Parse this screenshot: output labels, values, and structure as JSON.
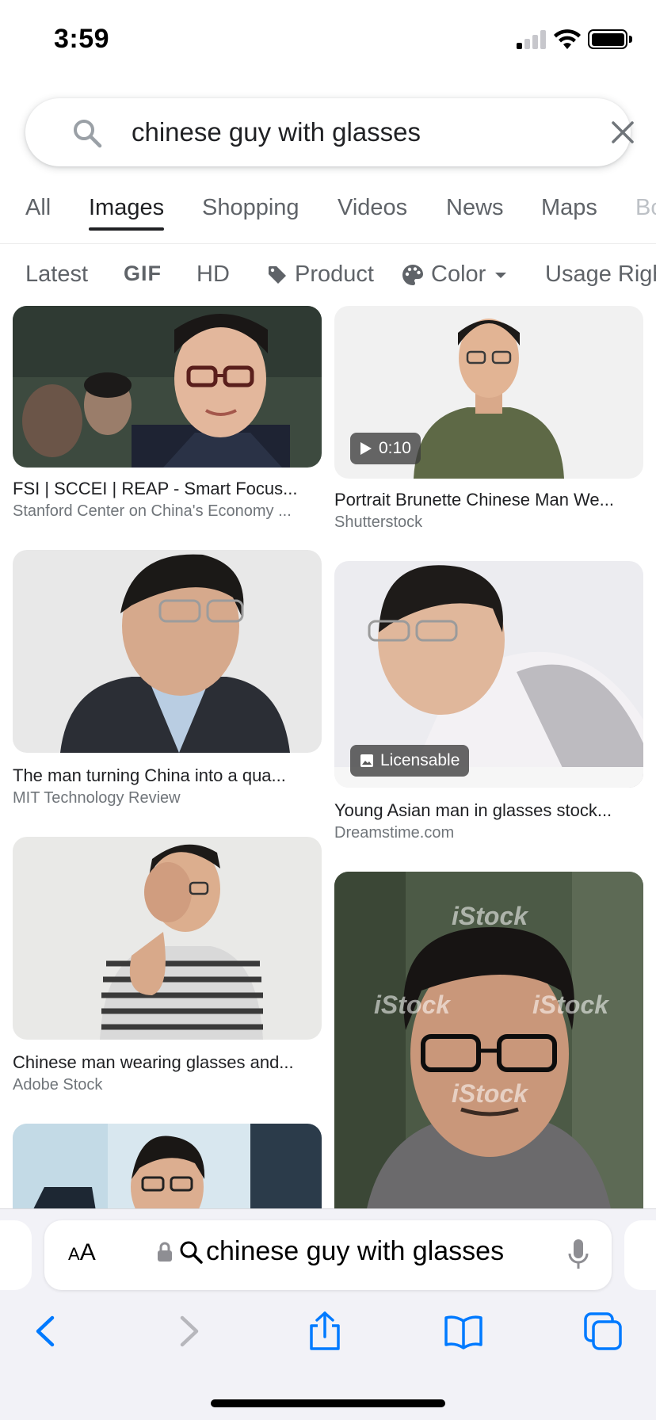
{
  "status_bar": {
    "time": "3:59"
  },
  "search": {
    "query": "chinese guy with glasses"
  },
  "tabs": [
    {
      "label": "All"
    },
    {
      "label": "Images"
    },
    {
      "label": "Shopping"
    },
    {
      "label": "Videos"
    },
    {
      "label": "News"
    },
    {
      "label": "Maps"
    },
    {
      "label": "Bo"
    }
  ],
  "filters": [
    {
      "label": "Latest"
    },
    {
      "label": "GIF"
    },
    {
      "label": "HD"
    },
    {
      "label": "Product"
    },
    {
      "label": "Color"
    },
    {
      "label": "Usage Righ"
    }
  ],
  "results": [
    {
      "title": "FSI | SCCEI | REAP - Smart Focus...",
      "source": "Stanford Center on China's Economy ..."
    },
    {
      "title": "Portrait Brunette Chinese Man We...",
      "source": "Shutterstock",
      "badge": "0:10"
    },
    {
      "title": "The man turning China into a qua...",
      "source": "MIT Technology Review"
    },
    {
      "title": "Young Asian man in glasses stock...",
      "source": "Dreamstime.com",
      "badge": "Licensable"
    },
    {
      "title": "Chinese man wearing glasses and...",
      "source": "Adobe Stock"
    },
    {
      "title": "",
      "source": "",
      "watermark": "iStock"
    },
    {
      "title": "",
      "source": ""
    }
  ],
  "browser": {
    "aa_label_small": "A",
    "aa_label_large": "A",
    "url_text": "chinese guy with glasses"
  },
  "colors": {
    "accent_text": "#202124",
    "muted_text": "#5f6368",
    "source_text": "#70757a",
    "ios_blue": "#007aff"
  }
}
